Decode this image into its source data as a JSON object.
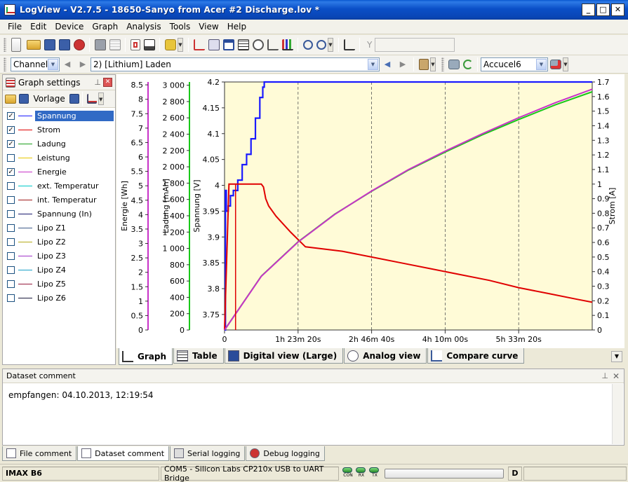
{
  "window": {
    "title": "LogView - V2.7.5 - 18650-Sanyo from Acer #2 Discharge.lov *",
    "minimize": "_",
    "maximize": "□",
    "close": "✕"
  },
  "menu": [
    "File",
    "Edit",
    "Device",
    "Graph",
    "Analysis",
    "Tools",
    "View",
    "Help"
  ],
  "toolbar": {
    "y_label": "Y",
    "y_value": "",
    "channel": "Channel1",
    "dataset": "2) [Lithium] Laden",
    "device_profile": "Accucel6"
  },
  "graph_settings": {
    "title": "Graph settings",
    "vorlage": "Vorlage",
    "series": [
      {
        "name": "Spannung",
        "checked": true,
        "color": "#1a1aff",
        "selected": true
      },
      {
        "name": "Strom",
        "checked": true,
        "color": "#e00000"
      },
      {
        "name": "Ladung",
        "checked": true,
        "color": "#1a9e1a"
      },
      {
        "name": "Leistung",
        "checked": false,
        "color": "#e6c800"
      },
      {
        "name": "Energie",
        "checked": true,
        "color": "#c832c8"
      },
      {
        "name": "ext. Temperatur",
        "checked": false,
        "color": "#00c8c8"
      },
      {
        "name": "int. Temperatur",
        "checked": false,
        "color": "#a01a1a"
      },
      {
        "name": "Spannung (In)",
        "checked": false,
        "color": "#1a1a6e"
      },
      {
        "name": "Lipo Z1",
        "checked": false,
        "color": "#3c5a8a"
      },
      {
        "name": "Lipo Z2",
        "checked": false,
        "color": "#b4aa1a"
      },
      {
        "name": "Lipo Z3",
        "checked": false,
        "color": "#a032c8"
      },
      {
        "name": "Lipo Z4",
        "checked": false,
        "color": "#1aa0c8"
      },
      {
        "name": "Lipo Z5",
        "checked": false,
        "color": "#961a3c"
      },
      {
        "name": "Lipo Z6",
        "checked": false,
        "color": "#1a1a3c"
      }
    ]
  },
  "graph_tabs": [
    "Graph",
    "Table",
    "Digital view (Large)",
    "Analog view",
    "Compare curve"
  ],
  "comment": {
    "title": "Dataset comment",
    "text": "empfangen: 04.10.2013, 12:19:54"
  },
  "dock_tabs": [
    "File comment",
    "Dataset comment",
    "Serial logging",
    "Debug logging"
  ],
  "status": {
    "device": "IMAX B6",
    "port": "COM5 - Silicon Labs CP210x USB to UART Bridge",
    "leds": [
      "CON",
      "RX",
      "TX"
    ],
    "mode": "D"
  },
  "chart_data": {
    "type": "line",
    "plot_background": "#fffbd7",
    "x_axis": {
      "ticks": [
        "0",
        "1h 23m 20s",
        "2h 46m 40s",
        "4h 10m 00s",
        "5h 33m 20s"
      ],
      "tick_values_s": [
        0,
        5000,
        10000,
        15000,
        20000
      ],
      "range_s": [
        0,
        25000
      ]
    },
    "axes": {
      "energie": {
        "label": "Energie [Wh]",
        "color": "#c832c8",
        "ticks": [
          "0",
          "0.5",
          "1",
          "1.5",
          "2",
          "2.5",
          "3",
          "3.5",
          "4",
          "4.5",
          "5",
          "5.5",
          "6",
          "6.5",
          "7",
          "7.5",
          "8",
          "8.5"
        ],
        "range": [
          0,
          8.6
        ]
      },
      "ladung": {
        "label": "Ladung [mAh]",
        "color": "#1ac81a",
        "ticks": [
          "0",
          "200",
          "400",
          "600",
          "800",
          "1 000",
          "1 200",
          "1 400",
          "1 600",
          "1 800",
          "2 000",
          "2 200",
          "2 400",
          "2 600",
          "2 800",
          "3 000"
        ],
        "range": [
          0,
          3040
        ]
      },
      "spannung": {
        "label": "Spannung [V]",
        "color": "#1a1aff",
        "ticks": [
          "3.75",
          "3.8",
          "3.85",
          "3.9",
          "3.95",
          "4",
          "4.05",
          "4.1",
          "4.15",
          "4.2"
        ],
        "range": [
          3.72,
          4.2
        ]
      },
      "strom": {
        "label": "Strom [A]",
        "color": "#e00000",
        "ticks": [
          "0",
          "0.1",
          "0.2",
          "0.3",
          "0.4",
          "0.5",
          "0.6",
          "0.7",
          "0.8",
          "0.9",
          "1",
          "1.1",
          "1.2",
          "1.3",
          "1.4",
          "1.5",
          "1.6",
          "1.7"
        ],
        "range": [
          0,
          1.7
        ]
      }
    },
    "series": [
      {
        "name": "Spannung",
        "axis": "spannung",
        "color": "#1a1aff",
        "x": [
          0,
          60,
          120,
          250,
          400,
          600,
          900,
          1200,
          1500,
          1800,
          2100,
          2400,
          2600,
          2700,
          25000
        ],
        "y": [
          3.72,
          3.99,
          3.95,
          3.96,
          3.98,
          3.99,
          4.01,
          4.04,
          4.06,
          4.09,
          4.13,
          4.17,
          4.19,
          4.2,
          4.2
        ]
      },
      {
        "name": "Strom",
        "axis": "strom",
        "color": "#e00000",
        "x": [
          0,
          300,
          600,
          2500,
          2650,
          2800,
          3000,
          3500,
          4500,
          5500,
          8000,
          10000,
          12000,
          14000,
          16000,
          18000,
          20000,
          22000,
          24000,
          25000
        ],
        "y": [
          0,
          1,
          1,
          1,
          0.98,
          0.9,
          0.85,
          0.78,
          0.67,
          0.57,
          0.54,
          0.5,
          0.46,
          0.42,
          0.38,
          0.34,
          0.29,
          0.25,
          0.21,
          0.19
        ]
      },
      {
        "name": "Ladung",
        "axis": "ladung",
        "color": "#1ac81a",
        "x": [
          0,
          2500,
          5000,
          7500,
          10000,
          12500,
          15000,
          17500,
          20000,
          22500,
          25000
        ],
        "y": [
          0,
          660,
          1080,
          1420,
          1700,
          1960,
          2180,
          2390,
          2580,
          2760,
          2920
        ]
      },
      {
        "name": "Energie",
        "axis": "energie",
        "color": "#c832c8",
        "x": [
          0,
          2500,
          5000,
          7500,
          10000,
          12500,
          15000,
          17500,
          20000,
          22500,
          25000
        ],
        "y": [
          0,
          1.86,
          3.05,
          4.01,
          4.82,
          5.56,
          6.2,
          6.8,
          7.36,
          7.88,
          8.35
        ]
      }
    ]
  }
}
